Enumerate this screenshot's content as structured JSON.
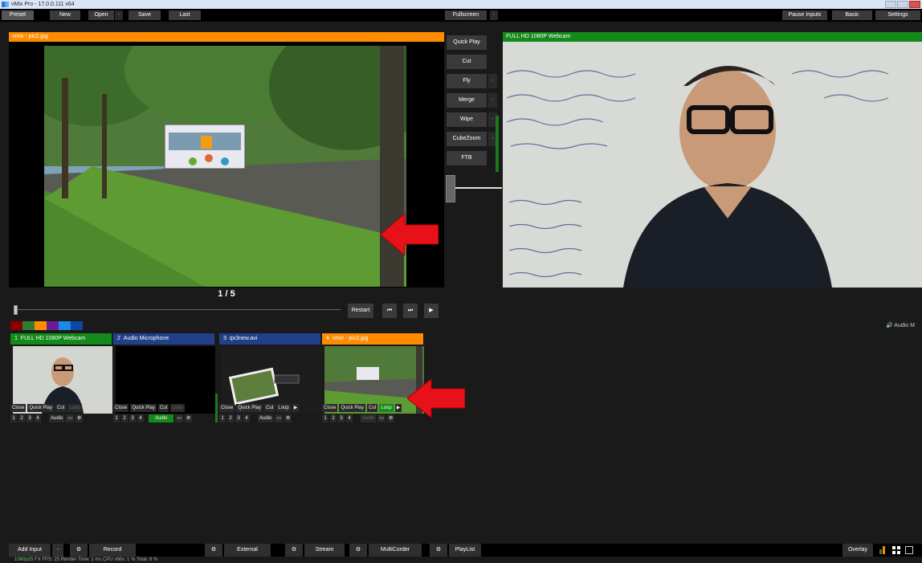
{
  "window": {
    "title": "vMix Pro - 17.0.0.111 x64"
  },
  "topbar": {
    "preset": "Preset",
    "new": "New",
    "open": "Open",
    "save": "Save",
    "last": "Last",
    "fullscreen": "Fullscreen",
    "pause_inputs": "Pause Inputs",
    "basic": "Basic",
    "settings": "Settings"
  },
  "preview": {
    "title": "vmix - pic2.jpg",
    "counter": "1 / 5"
  },
  "output": {
    "title": "FULL HD 1080P Webcam"
  },
  "transitions": {
    "quick_play": "Quick Play",
    "cut": "Cut",
    "fly": "Fly",
    "merge": "Merge",
    "wipe": "Wipe",
    "cubezoom": "CubeZoom",
    "ftb": "FTB"
  },
  "controls": {
    "restart": "Restart"
  },
  "colors": {
    "swatches": [
      "#8b0000",
      "#2e7d32",
      "#ff8c00",
      "#6a1b9a",
      "#1e88e5",
      "#0d47a1"
    ]
  },
  "audio_label": "Audio M",
  "inputs": [
    {
      "num": "1",
      "name": "FULL HD 1080P Webcam",
      "color": "#138a19",
      "loop": "Loop",
      "loop_active": false,
      "audio": "Audio",
      "audio_active": false
    },
    {
      "num": "2",
      "name": "Audio Microphone",
      "color": "#20408a",
      "loop": "Loop",
      "loop_active": false,
      "audio": "Audio",
      "audio_active": true
    },
    {
      "num": "3",
      "name": "qx3new.avi",
      "color": "#20408a",
      "loop": "Loop",
      "loop_active": false,
      "audio": "Audio",
      "audio_active": false
    },
    {
      "num": "4",
      "name": "vmix - pic2.jpg",
      "color": "#ff8c00",
      "loop": "Loop",
      "loop_active": true,
      "audio": "Audio",
      "audio_active": false
    }
  ],
  "input_row_labels": {
    "close": "Close",
    "quick_play": "Quick Play",
    "cut": "Cut",
    "nums": [
      "1",
      "2",
      "3",
      "4"
    ]
  },
  "bottombar": {
    "add_input": "Add Input",
    "record": "Record",
    "external": "External",
    "stream": "Stream",
    "multicorder": "MultiCorder",
    "playlist": "PlayList",
    "overlay": "Overlay"
  },
  "status": {
    "res": "1080p25",
    "text": "FX  FPS: 25  Render Time: 1 ms  CPU vMix: 1 %  Total: 6 %"
  }
}
